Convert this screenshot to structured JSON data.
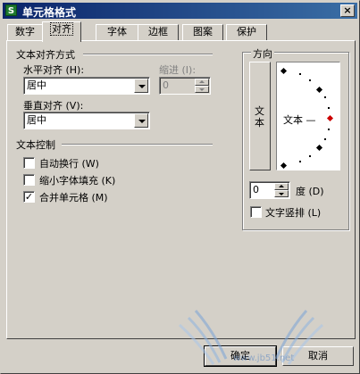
{
  "window": {
    "title": "单元格格式",
    "app_icon_letter": "S",
    "close_glyph": "×"
  },
  "tabs": [
    {
      "label": "数字",
      "active": false
    },
    {
      "label": "对齐",
      "active": true
    },
    {
      "label": "字体",
      "active": false
    },
    {
      "label": "边框",
      "active": false
    },
    {
      "label": "图案",
      "active": false
    },
    {
      "label": "保护",
      "active": false
    }
  ],
  "alignment": {
    "section_title": "文本对齐方式",
    "horizontal_label": "水平对齐 (H):",
    "horizontal_value": "居中",
    "indent_label": "缩进 (I):",
    "indent_value": "0",
    "vertical_label": "垂直对齐 (V):",
    "vertical_value": "居中"
  },
  "text_control": {
    "section_title": "文本控制",
    "items": [
      {
        "label": "自动换行 (W)",
        "checked": false,
        "mark": ""
      },
      {
        "label": "缩小字体填充 (K)",
        "checked": false,
        "mark": ""
      },
      {
        "label": "合并单元格 (M)",
        "checked": true,
        "mark": "✓"
      }
    ]
  },
  "orientation": {
    "section_title": "方向",
    "vertical_text_chars": [
      "文",
      "本"
    ],
    "dial_text": "文本 —",
    "degree_value": "0",
    "degree_label": "度 (D)",
    "vertical_checkbox_label": "文字竖排 (L)",
    "vertical_checkbox_checked": false,
    "vertical_checkbox_mark": ""
  },
  "buttons": {
    "ok": "确定",
    "cancel": "取消"
  },
  "watermark": {
    "text": "www.jb51.net"
  },
  "colors": {
    "title_start": "#0a246a",
    "title_end": "#3a6ea5",
    "dialog_bg": "#d4d0c8",
    "dial_marker": "#cc0000"
  }
}
